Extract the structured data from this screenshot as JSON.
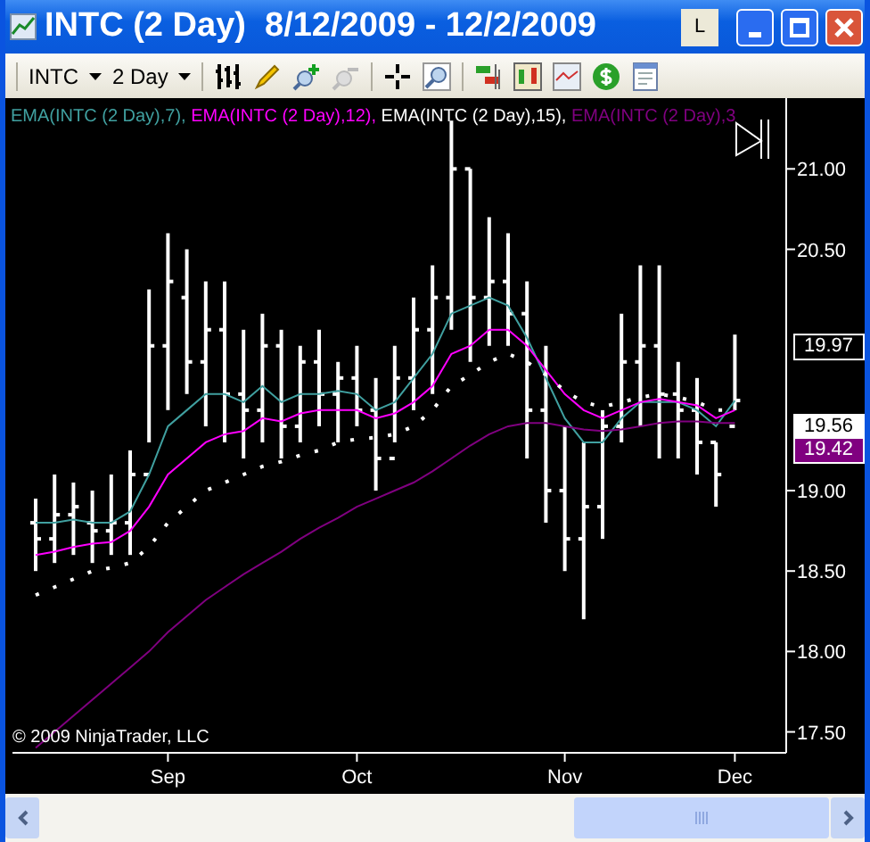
{
  "window": {
    "title": "INTC (2 Day)  8/12/2009 - 12/2/2009",
    "link_button": "L"
  },
  "toolbar": {
    "instrument": "INTC",
    "interval": "2 Day"
  },
  "chart": {
    "copyright": "© 2009 NinjaTrader, LLC",
    "price_markers": [
      {
        "label": "19.97",
        "color": "#000000"
      },
      {
        "label": "19.56",
        "color": "#ffffff"
      },
      {
        "label": "19.42",
        "color": "#800080"
      }
    ],
    "chart_data": {
      "type": "line",
      "ylim": [
        17.37,
        21.44
      ],
      "categories": [
        null,
        null,
        null,
        null,
        null,
        null,
        null,
        "Sep",
        null,
        null,
        null,
        null,
        null,
        null,
        null,
        null,
        null,
        "Oct",
        null,
        null,
        null,
        null,
        null,
        null,
        null,
        null,
        null,
        null,
        "Nov",
        null,
        null,
        null,
        null,
        null,
        null,
        null,
        null,
        "Dec"
      ],
      "yticks": [
        {
          "value": 17.5,
          "label": "17.50"
        },
        {
          "value": 18,
          "label": "18.00"
        },
        {
          "value": 18.5,
          "label": "18.50"
        },
        {
          "value": 19,
          "label": "19.00"
        },
        {
          "value": 20.5,
          "label": "20.50"
        },
        {
          "value": 21,
          "label": "21.00"
        }
      ],
      "series": [
        {
          "name": "EMA(INTC (2 Day),7),",
          "color": "#40a0a0",
          "values": [
            18.8,
            18.8,
            18.82,
            18.8,
            18.8,
            18.87,
            19.1,
            19.4,
            19.5,
            19.6,
            19.6,
            19.55,
            19.65,
            19.55,
            19.6,
            19.6,
            19.62,
            19.6,
            19.5,
            19.55,
            19.7,
            19.85,
            20.1,
            20.15,
            20.2,
            20.15,
            19.95,
            19.7,
            19.45,
            19.3,
            19.3,
            19.45,
            19.55,
            19.55,
            19.55,
            19.5,
            19.4,
            19.56
          ]
        },
        {
          "name": "EMA(INTC (2 Day),12),",
          "color": "#ff00ff",
          "values": [
            18.6,
            18.62,
            18.65,
            18.67,
            18.68,
            18.75,
            18.9,
            19.1,
            19.2,
            19.3,
            19.35,
            19.37,
            19.45,
            19.43,
            19.48,
            19.5,
            19.5,
            19.5,
            19.45,
            19.48,
            19.55,
            19.65,
            19.85,
            19.9,
            20.0,
            20.0,
            19.9,
            19.75,
            19.6,
            19.5,
            19.45,
            19.5,
            19.55,
            19.57,
            19.55,
            19.53,
            19.45,
            19.5
          ]
        },
        {
          "name": "EMA(INTC (2 Day),15),",
          "color": "#ffffff",
          "line_style": "dotted",
          "values": [
            18.35,
            18.4,
            18.45,
            18.5,
            18.52,
            18.55,
            18.65,
            18.8,
            18.9,
            19.0,
            19.05,
            19.1,
            19.15,
            19.18,
            19.22,
            19.25,
            19.3,
            19.32,
            19.33,
            19.35,
            19.4,
            19.5,
            19.65,
            19.72,
            19.8,
            19.85,
            19.8,
            19.72,
            19.62,
            19.55,
            19.52,
            19.55,
            19.58,
            19.6,
            19.58,
            19.55,
            19.5,
            19.5
          ]
        },
        {
          "name": "EMA(INTC (2 Day),3",
          "color": "#800080",
          "values": [
            17.4,
            17.5,
            17.6,
            17.7,
            17.8,
            17.9,
            18.0,
            18.12,
            18.22,
            18.32,
            18.4,
            18.48,
            18.55,
            18.62,
            18.7,
            18.77,
            18.83,
            18.9,
            18.95,
            19.0,
            19.05,
            19.12,
            19.2,
            19.28,
            19.35,
            19.4,
            19.42,
            19.42,
            19.4,
            19.38,
            19.37,
            19.38,
            19.4,
            19.42,
            19.43,
            19.43,
            19.42,
            19.42
          ]
        }
      ]
    }
  }
}
